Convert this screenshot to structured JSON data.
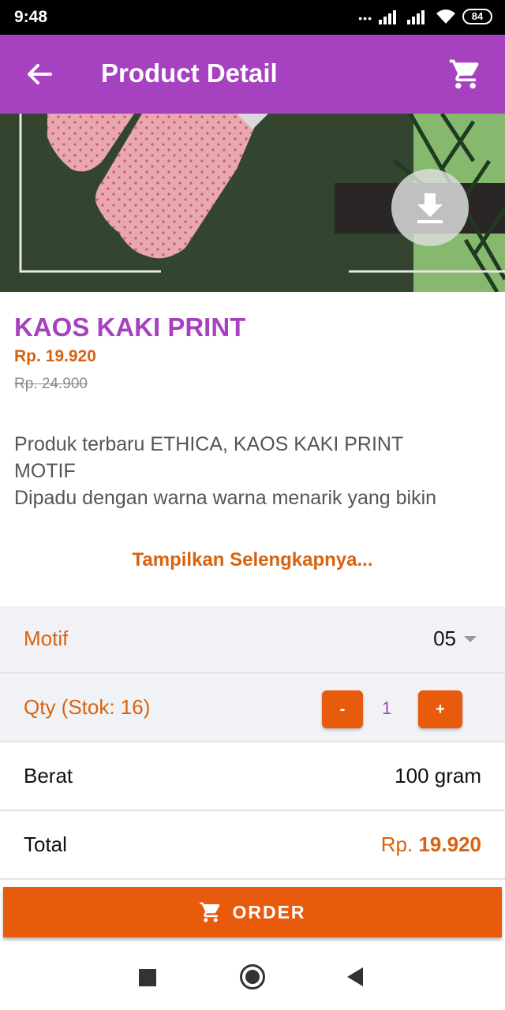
{
  "status_bar": {
    "time": "9:48",
    "battery": "84"
  },
  "app_bar": {
    "title": "Product Detail",
    "back_icon": "arrow-left-icon",
    "cart_icon": "shopping-cart-icon"
  },
  "image": {
    "action_icon": "download-icon"
  },
  "product": {
    "name": "KAOS KAKI PRINT",
    "price": "Rp. 19.920",
    "old_price": "Rp. 24.900",
    "description_lines": [
      "Produk terbaru ETHICA, KAOS KAKI PRINT",
      "MOTIF",
      "Dipadu dengan warna warna menarik yang bikin"
    ],
    "show_more": "Tampilkan Selengkapnya..."
  },
  "options": {
    "motif": {
      "label": "Motif",
      "value": "05"
    },
    "qty": {
      "label": "Qty (Stok: 16)",
      "minus": "-",
      "value": "1",
      "plus": "+"
    },
    "berat": {
      "label": "Berat",
      "value": "100 gram"
    },
    "total": {
      "label": "Total",
      "currency": "Rp.",
      "amount": "19.920"
    }
  },
  "order_button": {
    "label": "ORDER",
    "icon": "shopping-cart-icon"
  },
  "colors": {
    "accent": "#a641bf",
    "orange": "#e85a0c",
    "orange_text": "#d9620e"
  }
}
